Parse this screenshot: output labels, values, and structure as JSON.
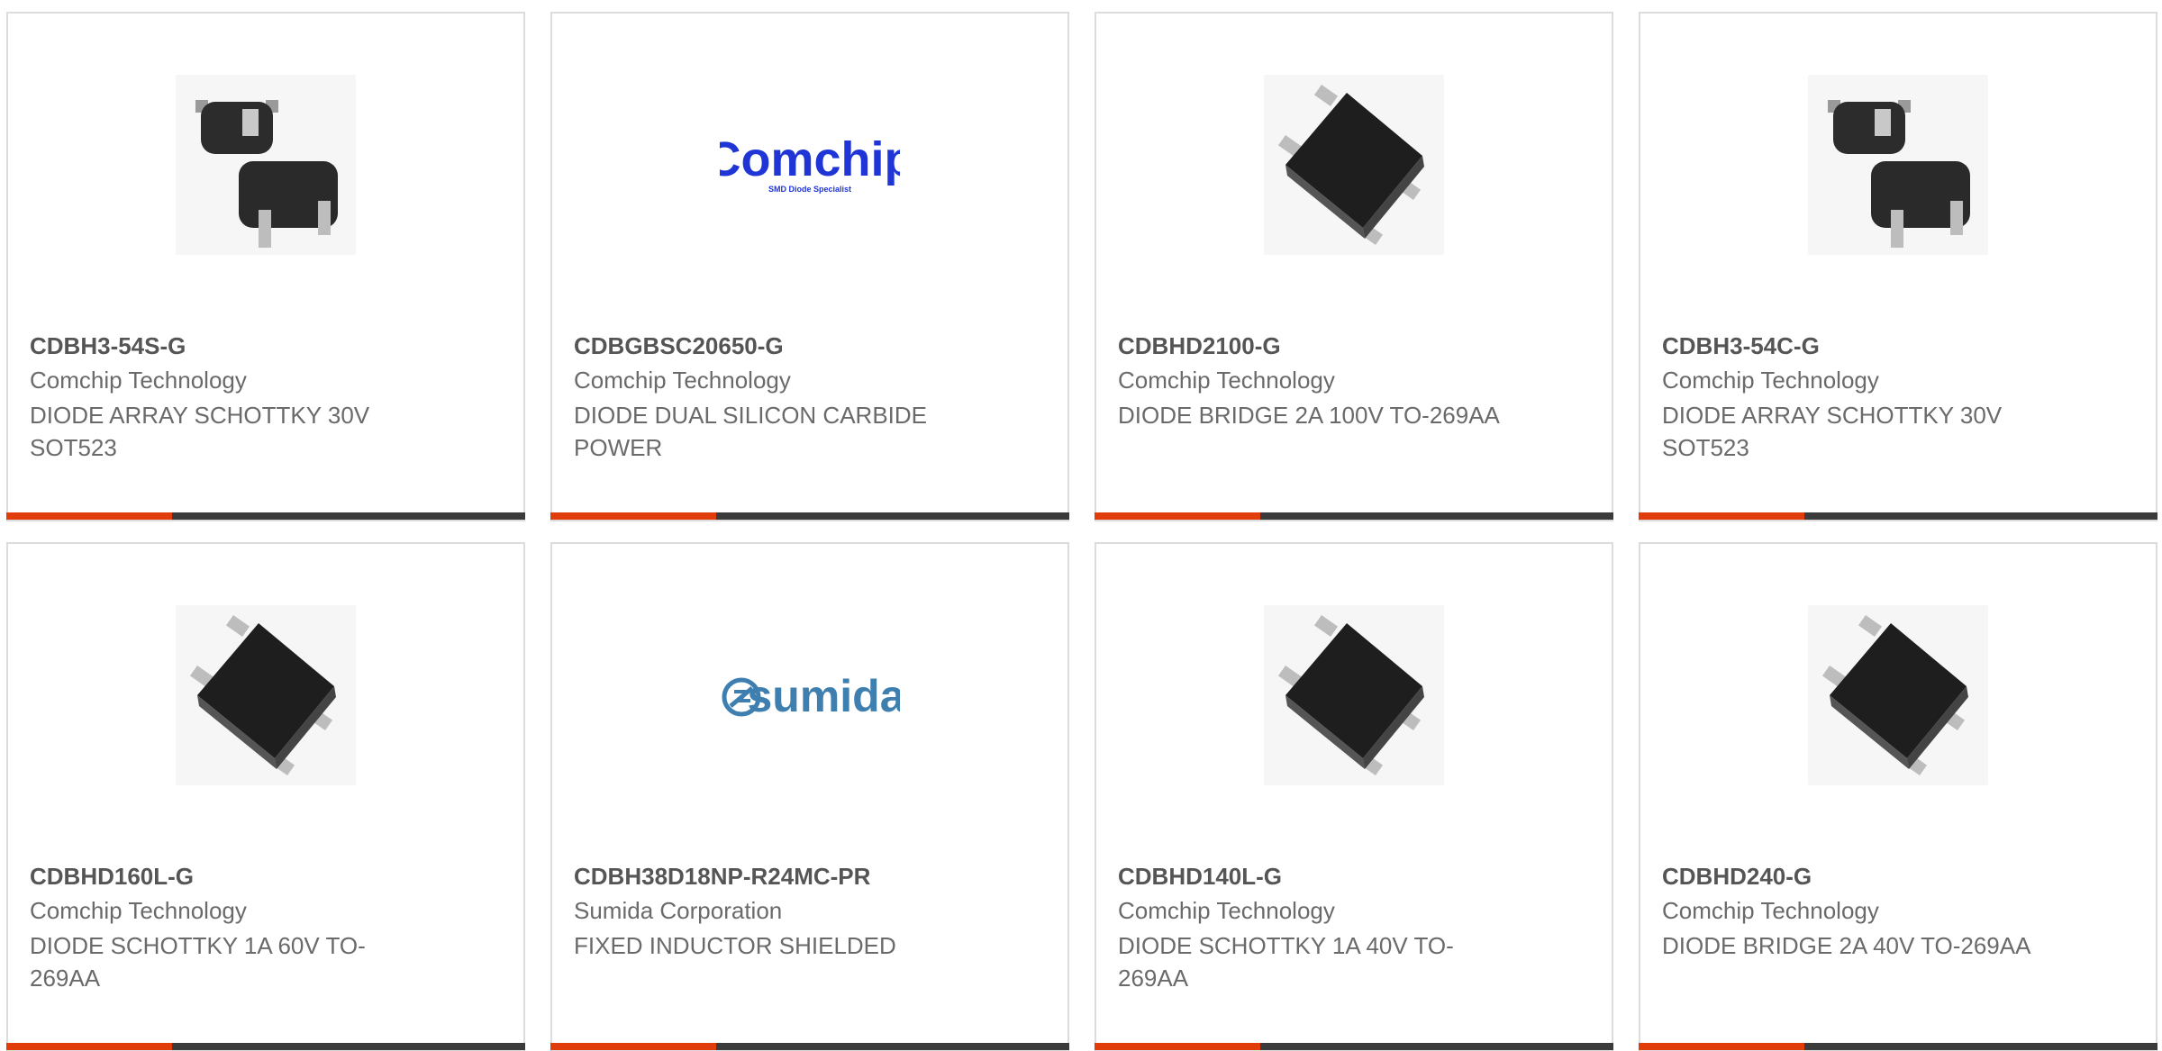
{
  "colors": {
    "accent": "#e03c0c",
    "bar": "#3b3b3b",
    "border": "#dcdcdc",
    "part_number": "#555555",
    "text": "#6a6a6a"
  },
  "products": [
    {
      "part_number": "CDBH3-54S-G",
      "manufacturer": "Comchip Technology",
      "description": "DIODE ARRAY SCHOTTKY 30V SOT523",
      "image": "sot523-package-image"
    },
    {
      "part_number": "CDBGBSC20650-G",
      "manufacturer": "Comchip Technology",
      "description": "DIODE DUAL SILICON CARBIDE POWER",
      "image": "comchip-logo",
      "logo_text": "Comchip",
      "logo_tagline": "SMD Diode Specialist"
    },
    {
      "part_number": "CDBHD2100-G",
      "manufacturer": "Comchip Technology",
      "description": "DIODE BRIDGE 2A 100V TO-269AA",
      "image": "to269aa-package-image"
    },
    {
      "part_number": "CDBH3-54C-G",
      "manufacturer": "Comchip Technology",
      "description": "DIODE ARRAY SCHOTTKY 30V SOT523",
      "image": "sot523-package-image"
    },
    {
      "part_number": "CDBHD160L-G",
      "manufacturer": "Comchip Technology",
      "description": "DIODE SCHOTTKY 1A 60V TO-269AA",
      "image": "to269aa-package-image"
    },
    {
      "part_number": "CDBH38D18NP-R24MC-PR",
      "manufacturer": "Sumida Corporation",
      "description": "FIXED INDUCTOR SHIELDED",
      "image": "sumida-logo",
      "logo_text": "sumida"
    },
    {
      "part_number": "CDBHD140L-G",
      "manufacturer": "Comchip Technology",
      "description": "DIODE SCHOTTKY 1A 40V TO-269AA",
      "image": "to269aa-package-image"
    },
    {
      "part_number": "CDBHD240-G",
      "manufacturer": "Comchip Technology",
      "description": "DIODE BRIDGE 2A 40V TO-269AA",
      "image": "to269aa-package-image"
    }
  ]
}
